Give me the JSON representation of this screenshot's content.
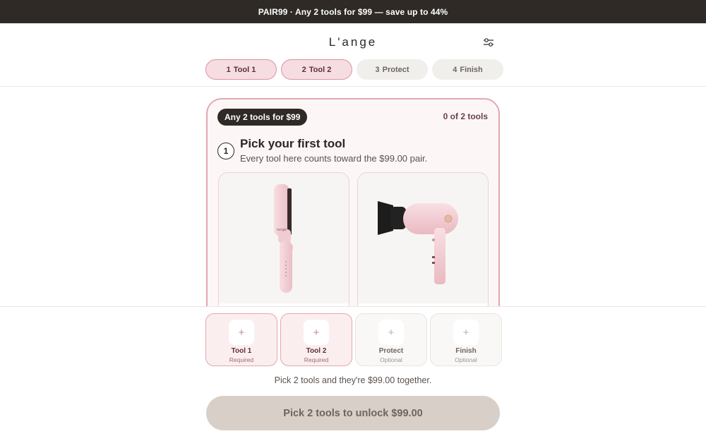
{
  "promo": {
    "text": "PAIR99 · Any 2 tools for $99 — save up to 44%"
  },
  "header": {
    "brand": "L'ange",
    "filter_icon": "sliders-icon"
  },
  "steps": [
    {
      "num": "1",
      "label": "Tool 1",
      "state": "active"
    },
    {
      "num": "2",
      "label": "Tool 2",
      "state": "active"
    },
    {
      "num": "3",
      "label": "Protect",
      "state": "inactive"
    },
    {
      "num": "4",
      "label": "Finish",
      "state": "inactive"
    }
  ],
  "card": {
    "badge": "Any 2 tools for $99",
    "count": "0 of 2 tools",
    "step_number": "1",
    "title": "Pick your first tool",
    "subtitle": "Every tool here counts toward the $99.00 pair.",
    "products": [
      {
        "icon": "hair-straightener-icon",
        "color": "#f3d4d9"
      },
      {
        "icon": "hair-dryer-icon",
        "color": "#f1cfd4"
      }
    ]
  },
  "tray": {
    "slots": [
      {
        "label": "Tool 1",
        "sub": "Required",
        "icon": "plus-icon"
      },
      {
        "label": "Tool 2",
        "sub": "Required",
        "icon": "plus-icon"
      },
      {
        "label": "Protect",
        "sub": "Optional",
        "icon": "plus-icon"
      },
      {
        "label": "Finish",
        "sub": "Optional",
        "icon": "plus-icon"
      }
    ],
    "note": "Pick 2 tools and they're $99.00 together.",
    "cta": "Pick 2 tools to unlock $99.00"
  },
  "colors": {
    "accent": "#e3a7b1",
    "dark": "#2f2a26",
    "cta_disabled": "#d8d0c8"
  }
}
